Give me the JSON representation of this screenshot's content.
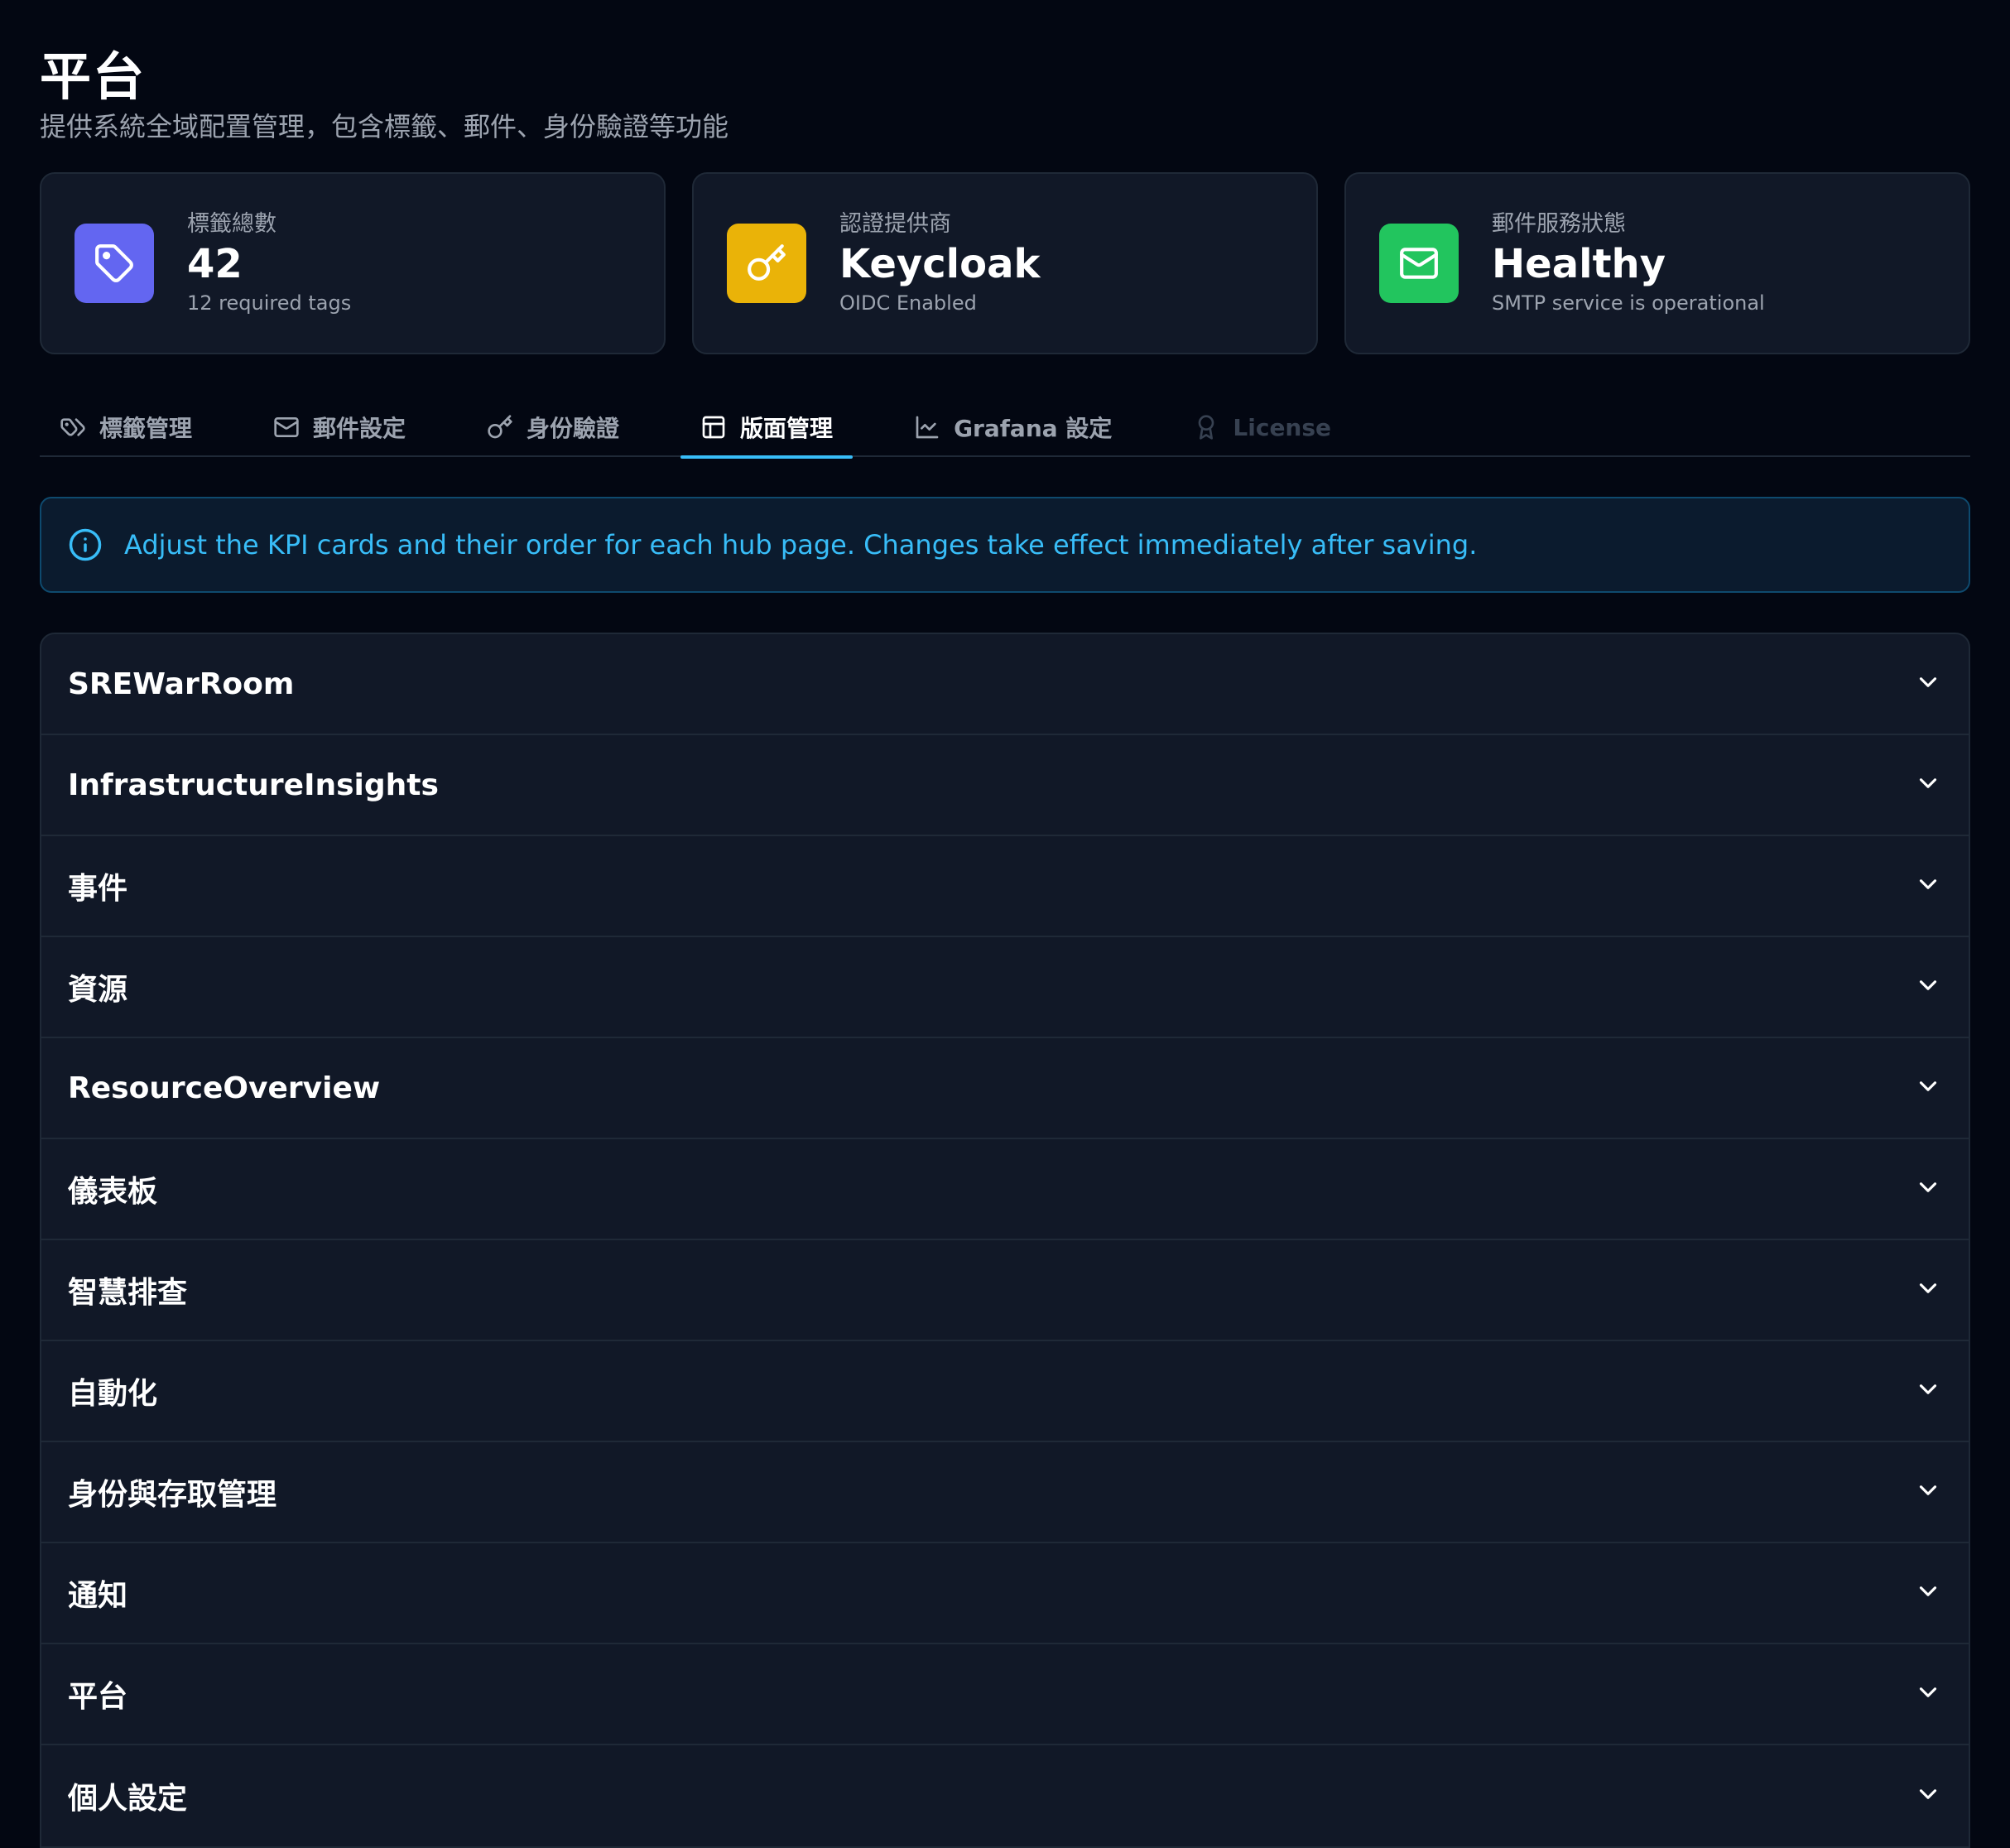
{
  "header": {
    "title": "平台",
    "subtitle": "提供系統全域配置管理，包含標籤、郵件、身份驗證等功能"
  },
  "kpis": [
    {
      "label": "標籤總數",
      "value": "42",
      "sub": "12 required tags",
      "icon": "tag-icon",
      "color": "#6366f1"
    },
    {
      "label": "認證提供商",
      "value": "Keycloak",
      "sub": "OIDC Enabled",
      "icon": "key-icon",
      "color": "#eab308"
    },
    {
      "label": "郵件服務狀態",
      "value": "Healthy",
      "sub": "SMTP service is operational",
      "icon": "mail-icon",
      "color": "#22c55e"
    }
  ],
  "tabs": [
    {
      "label": "標籤管理",
      "icon": "tag-icon",
      "state": "normal"
    },
    {
      "label": "郵件設定",
      "icon": "mail-icon",
      "state": "normal"
    },
    {
      "label": "身份驗證",
      "icon": "key-icon",
      "state": "normal"
    },
    {
      "label": "版面管理",
      "icon": "layout-icon",
      "state": "active"
    },
    {
      "label": "Grafana 設定",
      "icon": "chart-icon",
      "state": "normal"
    },
    {
      "label": "License",
      "icon": "award-icon",
      "state": "disabled"
    }
  ],
  "alert": {
    "text": "Adjust the KPI cards and their order for each hub page. Changes take effect immediately after saving.",
    "icon": "info-icon"
  },
  "sections": [
    "SREWarRoom",
    "InfrastructureInsights",
    "事件",
    "資源",
    "ResourceOverview",
    "儀表板",
    "智慧排查",
    "自動化",
    "身份與存取管理",
    "通知",
    "平台",
    "個人設定"
  ],
  "colors": {
    "background": "#030712",
    "card": "#111827",
    "border": "#1f2937",
    "accent": "#38bdf8",
    "muted": "#9ca3af"
  }
}
